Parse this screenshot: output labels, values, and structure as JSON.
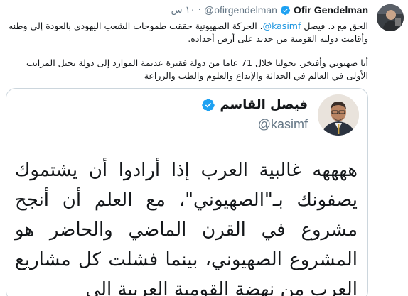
{
  "tweet": {
    "display_name": "Ofir Gendelman",
    "handle": "@ofirgendelman",
    "separator": "·",
    "time": "١٠ س",
    "paragraph1_before": "الحق مع د. فيصل ",
    "mention": "@kasimf",
    "paragraph1_after": ". الحركة الصهيونية حققت طموحات الشعب اليهودي بالعودة إلى وطنه وأقامت دولته القومية من جديد على أرض أجداده.",
    "paragraph2": "أنا صهيوني وأفتخر. تحولنا خلال 71 عاما من دولة فقيرة عديمة الموارد إلى دولة تحتل المراتب الأولى في العالم في الحداثة والإبداع والعلوم والطب والزراعة"
  },
  "embedded": {
    "display_name": "فيصل القاسم",
    "handle": "@kasimf",
    "text": "ههههه غالبية العرب إذا أرادوا أن يشتموك يصفونك بـ\"الصهيوني\"، مع العلم أن أنجح مشروع في القرن الماضي والحاضر هو المشروع الصهيوني، بينما فشلت كل مشاريع العرب من نهضة القومية العربية إلى"
  },
  "colors": {
    "link": "#1b95e0",
    "verified": "#1da1f2",
    "muted": "#657786",
    "border": "#ccd6dd"
  },
  "icons": {
    "verified": "verified-badge-icon"
  }
}
